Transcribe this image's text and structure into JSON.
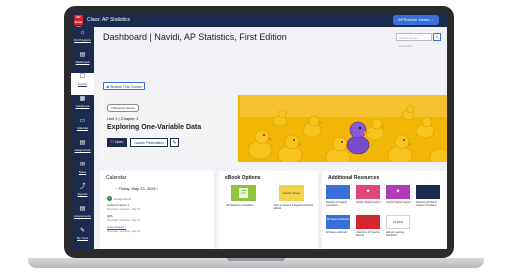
{
  "header": {
    "logo_text": "Mc Graw Hill",
    "class_title": "Class: AP Statistics",
    "user_button": "APTeacher Demo ⌄"
  },
  "sidebar": {
    "items": [
      {
        "icon": "⌂",
        "label": "My Programs"
      },
      {
        "icon": "▤",
        "label": "Dashboard"
      },
      {
        "icon": "☐",
        "label": "Course"
      },
      {
        "icon": "▦",
        "label": "Gradebook"
      },
      {
        "icon": "▭",
        "label": "Calendar"
      },
      {
        "icon": "▤",
        "label": "Assignments"
      },
      {
        "icon": "✉",
        "label": "Notes"
      },
      {
        "icon": "⤴",
        "label": "Reports"
      },
      {
        "icon": "▤",
        "label": "Assessments"
      },
      {
        "icon": "✎",
        "label": "My Tools"
      }
    ]
  },
  "main": {
    "title": "Dashboard | Navidi, AP Statistics, First Edition",
    "search_placeholder": "Search Course Resources",
    "search_icon": "⌕",
    "browse_label": "⇄ Browse This Course"
  },
  "hero": {
    "badge": "⊙ Recently Viewed",
    "unit": "Unit 1 | Chapter 1",
    "title": "Exploring One-Variable Data",
    "open_label": "☐ Open",
    "launch_label": "Launch Presentation",
    "edit_icon": "✎"
  },
  "calendar": {
    "title": "Calendar",
    "date_label": "‹   Friday, May 23, 2026   ›",
    "items": [
      {
        "label": "Assignments",
        "color": "#2e8b57"
      },
      {
        "label": "Lesson 2 Lesson 1",
        "color": "#222222"
      },
      {
        "label": "Due Date: Overdue - May 16",
        "color": "#777777"
      },
      {
        "label": "QRS",
        "color": "#222222"
      },
      {
        "label": "Due Date: Overdue - May 16",
        "color": "#777777"
      },
      {
        "label": "Jones Chapter 1",
        "color": "#1b5bbf"
      },
      {
        "label": "Due Date: Overdue - May 16",
        "color": "#777777"
      }
    ]
  },
  "ebook": {
    "title": "eBook Options",
    "items": [
      {
        "caption": "AP Statistics 1st Edition",
        "color": "#8cc63f"
      },
      {
        "caption": "How to Access Integrated Student eBook",
        "color": "#f2d24a",
        "thumb_text": "Guide Sheet"
      }
    ]
  },
  "resources": {
    "title": "Additional Resources",
    "items": [
      {
        "caption": "Statistics AP Statics Correlation",
        "color": "#3b6fd8"
      },
      {
        "caption": "Student Digital Support",
        "color": "#e0457b"
      },
      {
        "caption": "Teacher Digital Support",
        "color": "#b03ab8"
      },
      {
        "caption": "Statistics AP Statics Chapter Correlation",
        "color": "#1b2a4e"
      },
      {
        "caption": "AP Exam workbook",
        "color": "#3b6fd8",
        "thumb_text": "AP Exam workbook"
      },
      {
        "caption": "Customize AP Teacher Manual",
        "color": "#d6262b"
      },
      {
        "caption": "Aligned Learning Standards",
        "color": "#2e8b57",
        "thumb_text": "ALEKS"
      }
    ]
  }
}
